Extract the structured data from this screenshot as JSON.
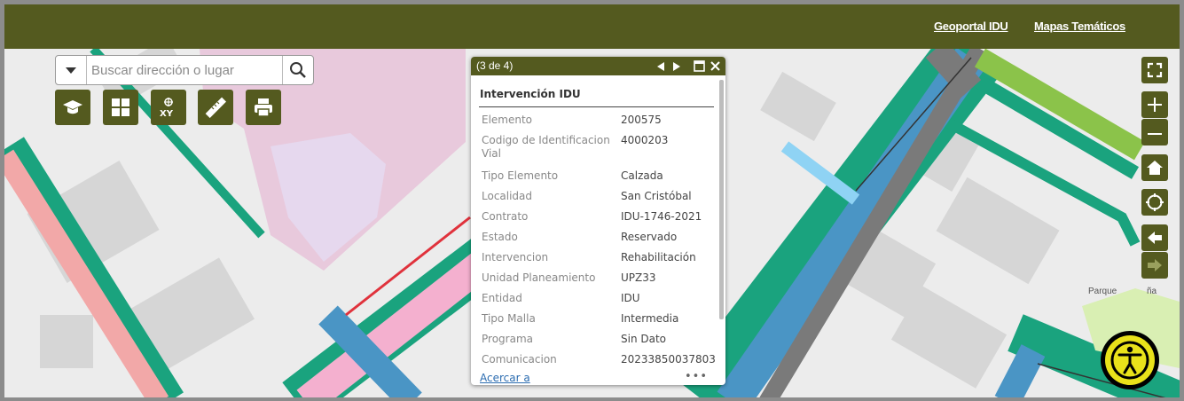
{
  "header": {
    "links": [
      {
        "label": "Geoportal IDU"
      },
      {
        "label": "Mapas Temáticos"
      }
    ]
  },
  "search": {
    "placeholder": "Buscar dirección o lugar"
  },
  "toolbar": {
    "icons": [
      "graduation-cap-icon",
      "grid-basemap-icon",
      "xy-coordinates-icon",
      "ruler-measure-icon",
      "printer-icon"
    ]
  },
  "map_controls": {
    "icons": [
      "fullscreen-icon",
      "zoom-in-icon",
      "zoom-out-icon",
      "home-icon",
      "locate-icon",
      "back-arrow-icon",
      "forward-arrow-icon"
    ]
  },
  "popup": {
    "counter": "(3 de 4)",
    "title": "Intervención IDU",
    "fields": [
      {
        "key": "Elemento",
        "value": "200575"
      },
      {
        "key": "Codigo de Identificacion Vial",
        "value": "4000203"
      },
      {
        "key": "Tipo Elemento",
        "value": "Calzada"
      },
      {
        "key": "Localidad",
        "value": "San Cristóbal"
      },
      {
        "key": "Contrato",
        "value": "IDU-1746-2021"
      },
      {
        "key": "Estado",
        "value": "Reservado"
      },
      {
        "key": "Intervencion",
        "value": "Rehabilitación"
      },
      {
        "key": "Unidad Planeamiento",
        "value": "UPZ33"
      },
      {
        "key": "Entidad",
        "value": "IDU"
      },
      {
        "key": "Tipo Malla",
        "value": "Intermedia"
      },
      {
        "key": "Programa",
        "value": "Sin Dato"
      },
      {
        "key": "Comunicacion",
        "value": "20233850037803"
      }
    ],
    "zoom_link": "Acercar a",
    "more": "•••"
  },
  "map_labels": {
    "park": "Parque",
    "park_suffix": "ña"
  },
  "colors": {
    "header": "#545a1f",
    "road_green": "#1aa37e",
    "road_blue": "#4a95c5",
    "road_pink": "#f2a8a8",
    "lime": "#8bc34a"
  }
}
